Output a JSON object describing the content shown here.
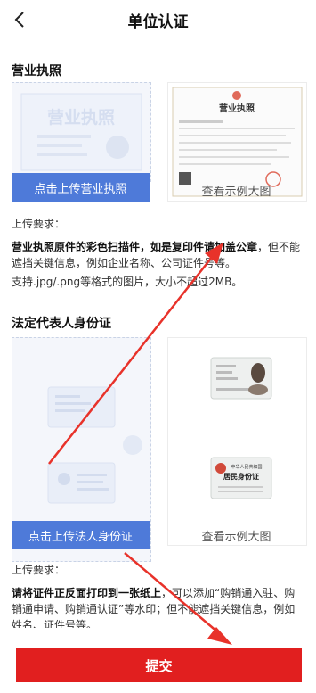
{
  "header": {
    "title": "单位认证",
    "back_icon": "chevron-left-icon"
  },
  "license": {
    "section_title": "营业执照",
    "placeholder_text": "营业执照",
    "upload_label": "点击上传营业执照",
    "sample_label": "查看示例大图",
    "sample_doc_title": "营业执照",
    "requirement_title": "上传要求：",
    "req_bold": "营业执照原件的彩色扫描件，如是复印件请加盖公章",
    "req_rest": "，但不能遮挡关键信息，例如企业名称、公司证件号等。",
    "format_note": "支持.jpg/.png等格式的图片，大小不超过2MB。"
  },
  "idcard": {
    "section_title": "法定代表人身份证",
    "upload_label": "点击上传法人身份证",
    "sample_label": "查看示例大图",
    "sample_back_line1": "中华人民共和国",
    "sample_back_line2": "居民身份证",
    "requirement_title": "上传要求：",
    "req_bold": "请将证件正反面打印到一张纸上",
    "req_rest": "，可以添加“购销通入驻、购销通申请、购销通认证”等水印；但不能遮挡关键信息，例如姓名、证件号等。"
  },
  "footer": {
    "submit_label": "提交"
  },
  "colors": {
    "accent": "#4e7ad9",
    "submit": "#e11f1f",
    "annotation": "#e8322a"
  }
}
